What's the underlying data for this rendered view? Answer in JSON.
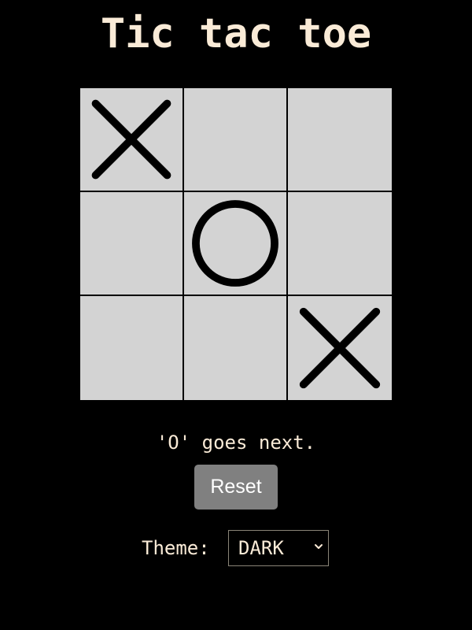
{
  "title": "Tic tac toe",
  "board": {
    "cells": [
      "X",
      "",
      "",
      "",
      "O",
      "",
      "",
      "",
      "X"
    ]
  },
  "status": "'O' goes next.",
  "reset_label": "Reset",
  "theme": {
    "label": "Theme:",
    "selected": "DARK"
  },
  "colors": {
    "background": "#000000",
    "text": "#faebd7",
    "board_cell": "#d3d3d3",
    "grid_line": "#000000",
    "mark": "#000000",
    "button": "#808080",
    "button_text": "#ffffff"
  },
  "icons": {
    "select_arrow": "chevron-down-icon"
  }
}
